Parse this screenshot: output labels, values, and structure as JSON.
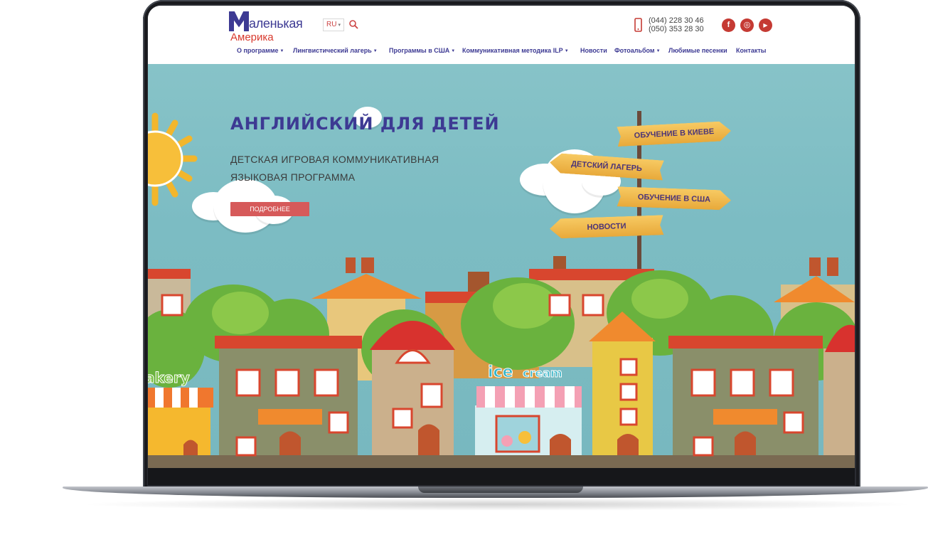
{
  "header": {
    "logo": {
      "line1": "аленькая",
      "line2": "Америка"
    },
    "lang": {
      "current": "RU"
    },
    "phones": [
      "(044) 228 30 46",
      "(050) 353 28 30"
    ],
    "social": [
      {
        "name": "facebook",
        "glyph": "f"
      },
      {
        "name": "instagram",
        "glyph": "◎"
      },
      {
        "name": "youtube",
        "glyph": "▶"
      }
    ]
  },
  "nav": [
    {
      "label": "О программе",
      "has_dropdown": true
    },
    {
      "label": "Лингвистический лагерь",
      "has_dropdown": true
    },
    {
      "label": "Программы в США",
      "has_dropdown": true
    },
    {
      "label": "Коммуникативная методика ILP",
      "has_dropdown": true
    },
    {
      "label": "Новости",
      "has_dropdown": false
    },
    {
      "label": "Фотоальбом",
      "has_dropdown": true
    },
    {
      "label": "Любимые песенки",
      "has_dropdown": false
    },
    {
      "label": "Контакты",
      "has_dropdown": false
    }
  ],
  "hero": {
    "title": "АНГЛИЙСКИЙ ДЛЯ ДЕТЕЙ",
    "subtitle_line1": "ДЕТСКАЯ ИГРОВАЯ КОММУНИКАТИВНАЯ",
    "subtitle_line2": "ЯЗЫКОВАЯ ПРОГРАММА",
    "button": "ПОДРОБНЕЕ",
    "signs": [
      "ОБУЧЕНИЕ В КИЕВЕ",
      "ДЕТСКИЙ ЛАГЕРЬ",
      "ОБУЧЕНИЕ В США",
      "НОВОСТИ"
    ],
    "shop_signs": {
      "bakery": "akery",
      "icecream_1": "ice",
      "icecream_2": "cream"
    }
  },
  "colors": {
    "brand": "#3d3a93",
    "accent": "#d83a2e",
    "sky": "#7cbcc3",
    "button": "#d65a5a"
  }
}
